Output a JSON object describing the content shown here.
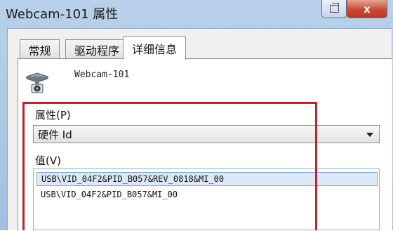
{
  "window": {
    "title": "Webcam-101 属性",
    "close_glyph": "x"
  },
  "tabs": [
    {
      "label": "常规"
    },
    {
      "label": "驱动程序"
    },
    {
      "label": "详细信息",
      "selected": true
    }
  ],
  "device": {
    "icon": "webcam-icon",
    "name": "Webcam-101"
  },
  "property": {
    "label": "属性(P)",
    "selected": "硬件 Id"
  },
  "value": {
    "label": "值(V)",
    "items": [
      {
        "text": "USB\\VID_04F2&PID_B057&REV_0818&MI_00",
        "selected": true
      },
      {
        "text": "USB\\VID_04F2&PID_B057&MI_00",
        "selected": false
      }
    ]
  },
  "colors": {
    "highlight": "#d01c2a",
    "close_button": "#c94a34"
  }
}
